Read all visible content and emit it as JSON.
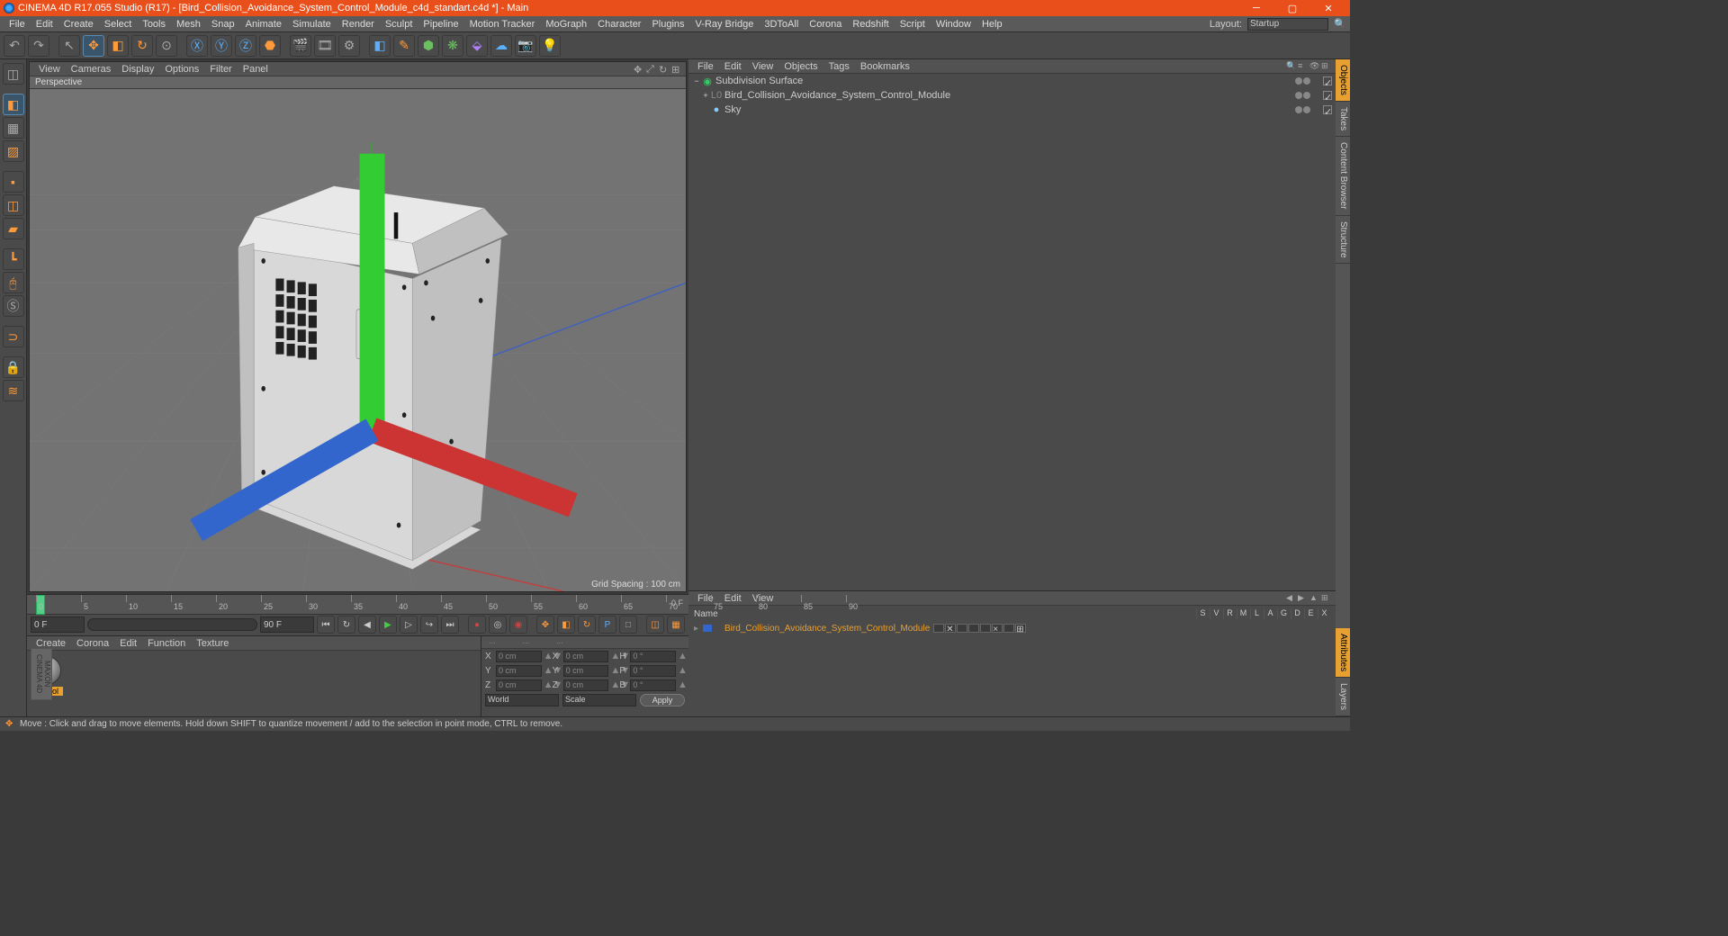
{
  "title": "CINEMA 4D R17.055 Studio (R17) - [Bird_Collision_Avoidance_System_Control_Module_c4d_standart.c4d *] - Main",
  "menubar": {
    "items": [
      "File",
      "Edit",
      "Create",
      "Select",
      "Tools",
      "Mesh",
      "Snap",
      "Animate",
      "Simulate",
      "Render",
      "Sculpt",
      "Pipeline",
      "Motion Tracker",
      "MoGraph",
      "Character",
      "Plugins",
      "V-Ray Bridge",
      "3DToAll",
      "Corona",
      "Redshift",
      "Script",
      "Window",
      "Help"
    ],
    "layout_label": "Layout:",
    "layout_value": "Startup"
  },
  "viewport": {
    "menu": [
      "View",
      "Cameras",
      "Display",
      "Options",
      "Filter",
      "Panel"
    ],
    "label": "Perspective",
    "grid_info": "Grid Spacing : 100 cm"
  },
  "timeline": {
    "start_field": "0 F",
    "end_field": "90 F",
    "min_field": "0 F",
    "max_field": "90 F",
    "current": "0 F",
    "marks": [
      0,
      5,
      10,
      15,
      20,
      25,
      30,
      35,
      40,
      45,
      50,
      55,
      60,
      65,
      70,
      75,
      80,
      85,
      90
    ]
  },
  "material": {
    "menu": [
      "Create",
      "Corona",
      "Edit",
      "Function",
      "Texture"
    ],
    "item_label": "control",
    "logo": "MAXON CINEMA 4D"
  },
  "coords": {
    "header": [
      "...",
      "...",
      "..."
    ],
    "rows": [
      {
        "axis": "X",
        "pos": "0 cm",
        "size_lbl": "X",
        "size": "0 cm",
        "rot_lbl": "H",
        "rot": "0 °"
      },
      {
        "axis": "Y",
        "pos": "0 cm",
        "size_lbl": "Y",
        "size": "0 cm",
        "rot_lbl": "P",
        "rot": "0 °"
      },
      {
        "axis": "Z",
        "pos": "0 cm",
        "size_lbl": "Z",
        "size": "0 cm",
        "rot_lbl": "B",
        "rot": "0 °"
      }
    ],
    "mode_pos": "World",
    "mode_size": "Scale",
    "apply": "Apply"
  },
  "obj_manager": {
    "menu": [
      "File",
      "Edit",
      "View",
      "Objects",
      "Tags",
      "Bookmarks"
    ],
    "tree": [
      {
        "expand": "−",
        "icon": "subdiv",
        "name": "Subdivision Surface",
        "indent": 0
      },
      {
        "expand": "+",
        "icon": "null",
        "name": "Bird_Collision_Avoidance_System_Control_Module",
        "indent": 1
      },
      {
        "expand": "",
        "icon": "sky",
        "name": "Sky",
        "indent": 1
      }
    ]
  },
  "attr_manager": {
    "menu": [
      "File",
      "Edit",
      "View"
    ],
    "name_label": "Name",
    "tags": [
      "S",
      "V",
      "R",
      "M",
      "L",
      "A",
      "G",
      "D",
      "E",
      "X"
    ],
    "obj_name": "Bird_Collision_Avoidance_System_Control_Module"
  },
  "right_tabs": {
    "top": [
      "Objects",
      "Takes",
      "Content Browser",
      "Structure"
    ],
    "bottom": [
      "Attributes",
      "Layers"
    ]
  },
  "statusbar": "Move : Click and drag to move elements. Hold down SHIFT to quantize movement / add to the selection in point mode, CTRL to remove."
}
